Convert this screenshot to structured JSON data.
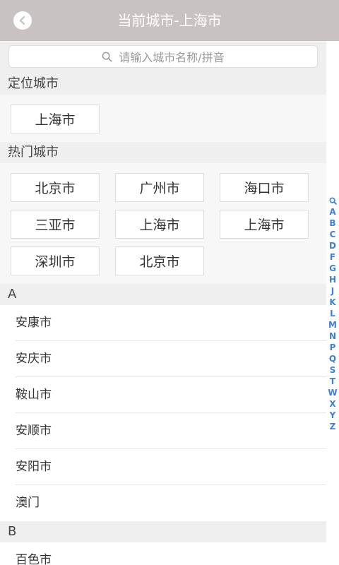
{
  "header": {
    "title": "当前城市-上海市"
  },
  "search": {
    "placeholder": "请输入城市名称/拼音"
  },
  "located": {
    "title": "定位城市",
    "city": "上海市"
  },
  "hot": {
    "title": "热门城市",
    "rows": [
      [
        "北京市",
        "广州市",
        "海口市"
      ],
      [
        "三亚市",
        "上海市",
        "上海市"
      ],
      [
        "深圳市",
        "北京市"
      ]
    ]
  },
  "groups": [
    {
      "letter": "A",
      "cities": [
        "安康市",
        "安庆市",
        "鞍山市",
        "安顺市",
        "安阳市",
        "澳门"
      ]
    },
    {
      "letter": "B",
      "cities": [
        "百色市"
      ]
    }
  ],
  "index": [
    "A",
    "B",
    "C",
    "D",
    "F",
    "G",
    "H",
    "J",
    "K",
    "L",
    "M",
    "N",
    "P",
    "Q",
    "S",
    "T",
    "W",
    "X",
    "Y",
    "Z"
  ],
  "colors": {
    "header_bg": "#c9c2c2",
    "index_accent": "#3d7fd9"
  },
  "icons": {
    "back": "chevron-left-icon",
    "search": "search-icon"
  }
}
